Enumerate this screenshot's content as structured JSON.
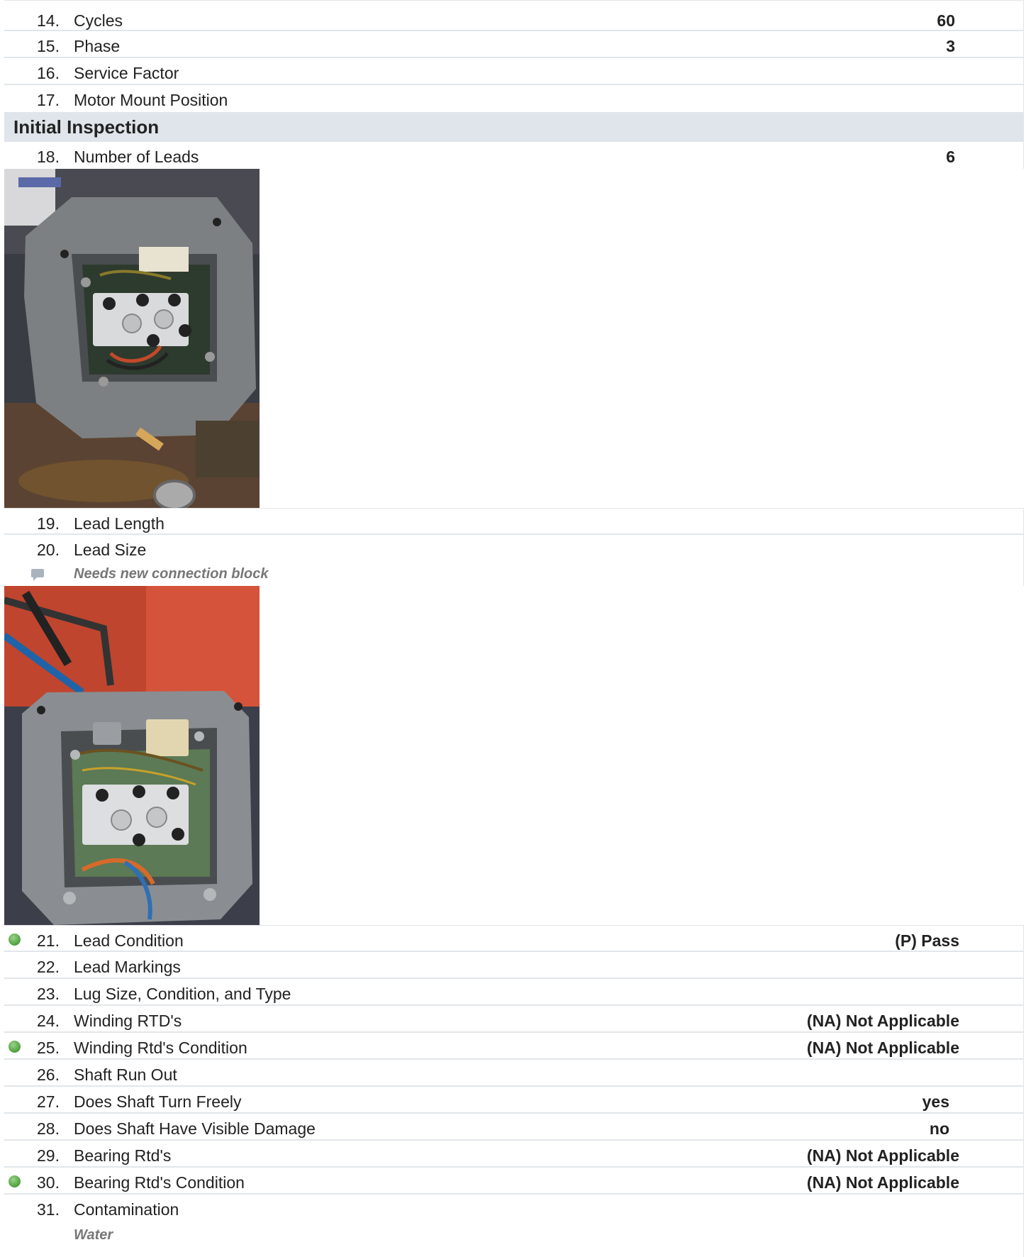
{
  "rows_top": [
    {
      "num": "14.",
      "label": "Cycles",
      "value": "60"
    },
    {
      "num": "15.",
      "label": "Phase",
      "value": "3"
    },
    {
      "num": "16.",
      "label": "Service Factor",
      "value": ""
    },
    {
      "num": "17.",
      "label": "Motor Mount Position",
      "value": ""
    }
  ],
  "section_title": "Initial Inspection",
  "row_18": {
    "num": "18.",
    "label": "Number of Leads",
    "value": "6"
  },
  "rows_mid": [
    {
      "num": "19.",
      "label": "Lead Length"
    },
    {
      "num": "20.",
      "label": "Lead Size"
    }
  ],
  "note_20": "Needs new connection block",
  "rows_bottom": [
    {
      "num": "21.",
      "label": "Lead Condition",
      "value": "(P) Pass",
      "status": "pass"
    },
    {
      "num": "22.",
      "label": "Lead Markings",
      "value": ""
    },
    {
      "num": "23.",
      "label": "Lug Size, Condition, and Type",
      "value": ""
    },
    {
      "num": "24.",
      "label": "Winding RTD's",
      "value": "(NA) Not Applicable"
    },
    {
      "num": "25.",
      "label": "Winding Rtd's Condition",
      "value": "(NA) Not Applicable",
      "status": "pass"
    },
    {
      "num": "26.",
      "label": "Shaft Run Out",
      "value": ""
    },
    {
      "num": "27.",
      "label": "Does Shaft Turn Freely",
      "value": "yes"
    },
    {
      "num": "28.",
      "label": "Does Shaft Have Visible Damage",
      "value": "no"
    },
    {
      "num": "29.",
      "label": "Bearing Rtd's",
      "value": "(NA) Not Applicable"
    },
    {
      "num": "30.",
      "label": "Bearing Rtd's Condition",
      "value": "(NA) Not Applicable",
      "status": "pass"
    }
  ],
  "row_31": {
    "num": "31.",
    "label": "Contamination",
    "note": "Water"
  },
  "status_color": "#5caa4a"
}
